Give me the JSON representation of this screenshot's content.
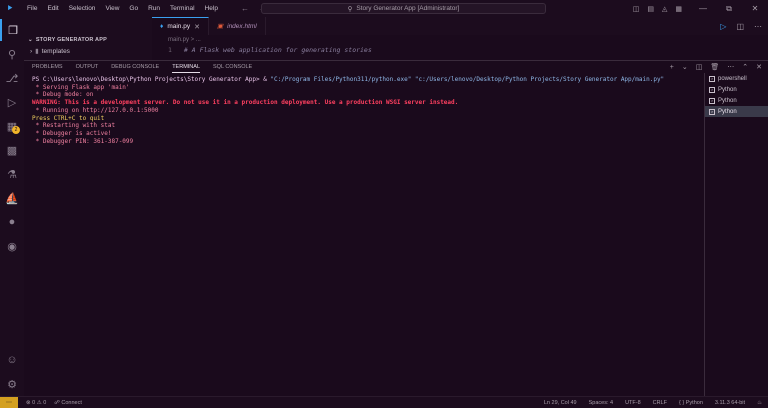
{
  "titlebar": {
    "menu": [
      "File",
      "Edit",
      "Selection",
      "View",
      "Go",
      "Run",
      "Terminal",
      "Help"
    ],
    "search_text": "Story Generator App [Administrator]"
  },
  "sidebar": {
    "header": "STORY GENERATOR APP",
    "folder": "templates",
    "badge_count": "2"
  },
  "editor": {
    "tabs": [
      {
        "label": "main.py",
        "active": true
      },
      {
        "label": "index.html",
        "active": false
      }
    ],
    "breadcrumb": "main.py > ...",
    "line_number": "1",
    "line_text": "# A Flask web application for generating stories"
  },
  "panel": {
    "tabs": [
      "PROBLEMS",
      "OUTPUT",
      "DEBUG CONSOLE",
      "TERMINAL",
      "SQL CONSOLE"
    ],
    "active_tab": "TERMINAL",
    "terminal": {
      "prompt": "PS C:\\Users\\lenovo\\Desktop\\Python Projects\\Story Generator App> ",
      "cmd_amp": "& ",
      "cmd_exe": "\"C:/Program Files/Python311/python.exe\" ",
      "cmd_script": "\"c:/Users/lenovo/Desktop/Python Projects/Story Generator App/main.py\"",
      "l1": " * Serving Flask app 'main'",
      "l2": " * Debug mode: on",
      "l3": "WARNING: This is a development server. Do not use it in a production deployment. Use a production WSGI server instead.",
      "l4": " * Running on http://127.0.0.1:5000",
      "l5": "Press CTRL+C to quit",
      "l6": " * Restarting with stat",
      "l7": " * Debugger is active!",
      "l8": " * Debugger PIN: 361-387-099"
    },
    "terminals": [
      "powershell",
      "Python",
      "Python",
      "Python"
    ]
  },
  "statusbar": {
    "errors": "0",
    "warnings": "0",
    "connect": "Connect",
    "position": "Ln 29, Col 49",
    "spaces": "Spaces: 4",
    "encoding": "UTF-8",
    "eol": "CRLF",
    "language": "Python",
    "interpreter": "3.11.3 64-bit"
  },
  "colors": {
    "accent": "#3aa0f0",
    "warning": "#ff4060",
    "background": "#1a0a1c"
  }
}
